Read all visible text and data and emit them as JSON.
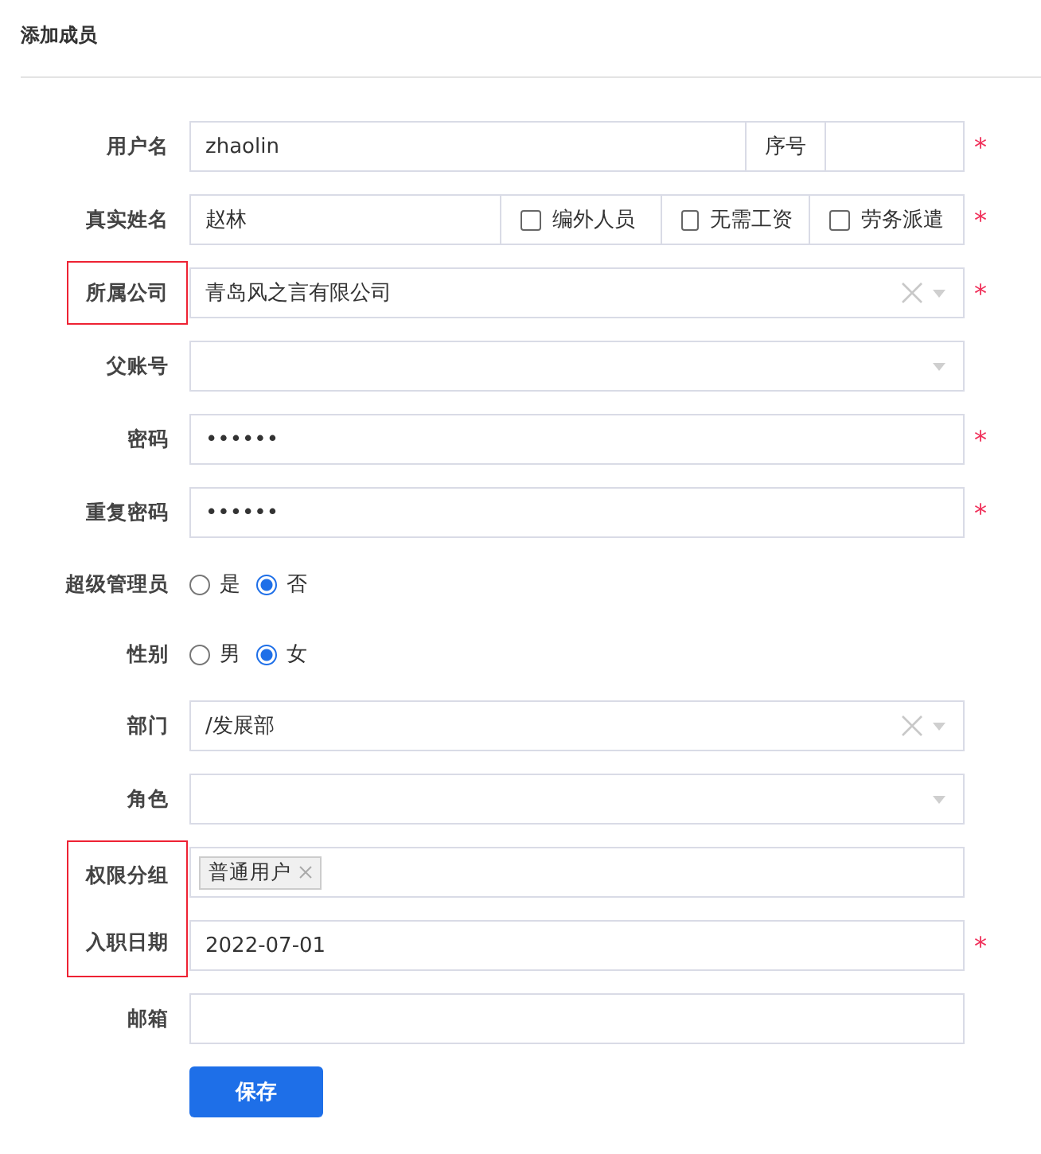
{
  "title": "添加成员",
  "required_mark": "*",
  "fields": [
    {
      "kind": "text",
      "label": "用户名",
      "value": "zhaolin",
      "required": true,
      "addon": "序号"
    },
    {
      "kind": "checks",
      "label": "真实姓名",
      "value": "赵林",
      "required": true,
      "checks": [
        {
          "label": "编外人员",
          "checked": false
        },
        {
          "label": "无需工资",
          "checked": false
        },
        {
          "label": "劳务派遣",
          "checked": false
        }
      ]
    },
    {
      "kind": "select",
      "label": "所属公司",
      "value": "青岛风之言有限公司",
      "clearable": true,
      "required": true,
      "highlighted": true
    },
    {
      "kind": "select",
      "label": "父账号"
    },
    {
      "kind": "text",
      "label": "密码",
      "value": "••••••",
      "required": true
    },
    {
      "kind": "text",
      "label": "重复密码",
      "value": "••••••",
      "required": true
    },
    {
      "kind": "radio",
      "label": "超级管理员",
      "options": [
        {
          "label": "是",
          "selected": false
        },
        {
          "label": "否",
          "selected": true
        }
      ]
    },
    {
      "kind": "radio",
      "label": "性别",
      "options": [
        {
          "label": "男",
          "selected": false
        },
        {
          "label": "女",
          "selected": true
        }
      ]
    },
    {
      "kind": "select",
      "label": "部门",
      "value": "/发展部",
      "clearable": true
    },
    {
      "kind": "select",
      "label": "角色"
    },
    {
      "kind": "tags",
      "label": "权限分组",
      "tags": [
        "普通用户"
      ],
      "highlighted": true
    },
    {
      "kind": "text",
      "label": "入职日期",
      "value": "2022-07-01",
      "required": true,
      "highlighted": true
    },
    {
      "kind": "text",
      "label": "邮箱"
    }
  ],
  "save_button": "保存"
}
